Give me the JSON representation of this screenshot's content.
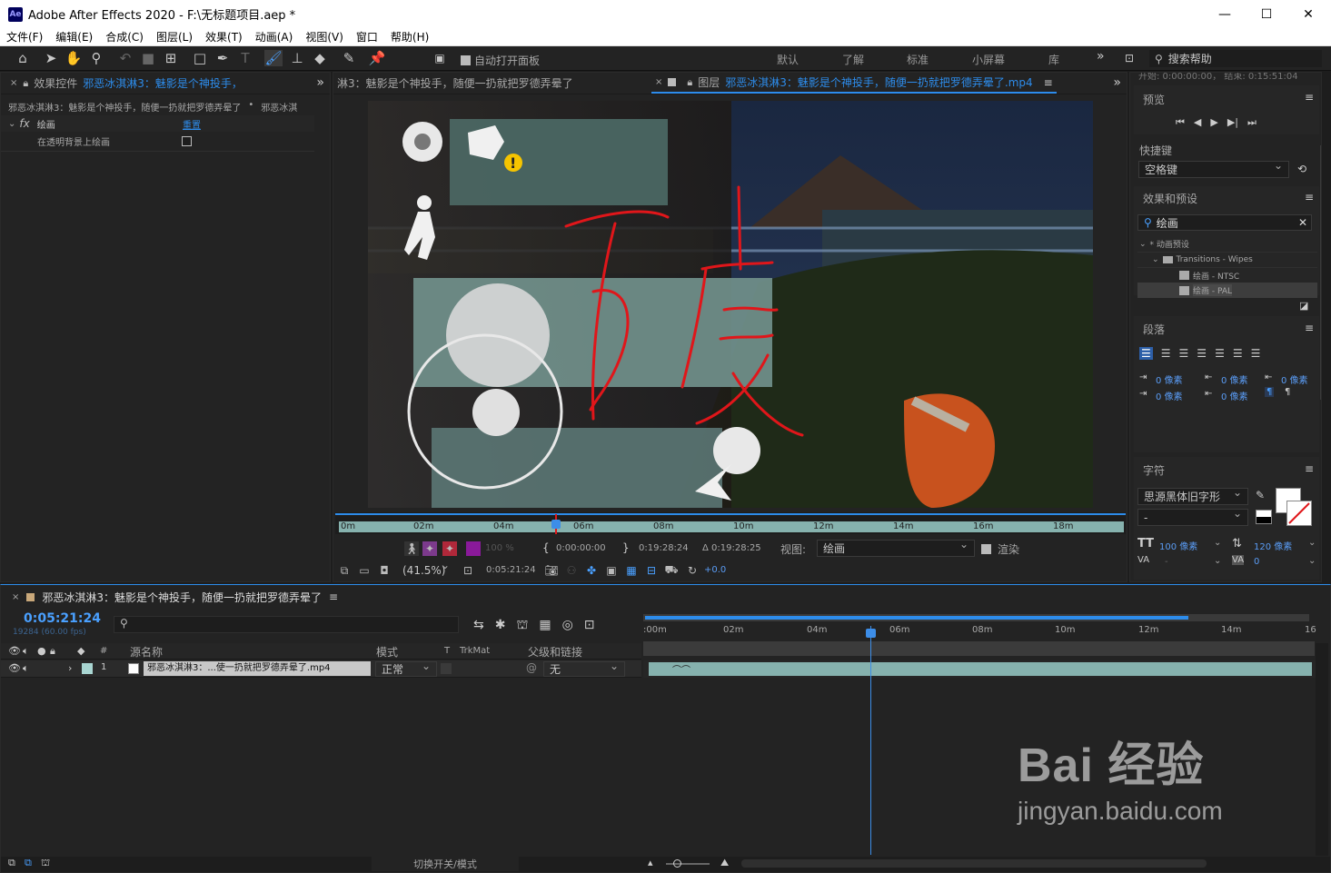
{
  "window": {
    "app_icon": "Ae",
    "title": "Adobe After Effects 2020 - F:\\无标题项目.aep *",
    "minimize": "—",
    "maximize": "☐",
    "close": "✕"
  },
  "menu": [
    "文件(F)",
    "编辑(E)",
    "合成(C)",
    "图层(L)",
    "效果(T)",
    "动画(A)",
    "视图(V)",
    "窗口",
    "帮助(H)"
  ],
  "toolbar": {
    "auto_open_label": "自动打开面板",
    "auto_open_checked": true,
    "workspaces": [
      "默认",
      "了解",
      "标准",
      "小屏幕",
      "库"
    ],
    "more": "»",
    "search_help": "搜索帮助"
  },
  "effect_controls": {
    "close": "×",
    "tab_prefix": "效果控件",
    "tab_layer": "邪恶冰淇淋3：魅影是个神投手，",
    "more": "»",
    "breadcrumb_a": "邪恶冰淇淋3：魅影是个神投手，随便一扔就把罗德弄晕了",
    "breadcrumb_sep": "•",
    "breadcrumb_b": "邪恶冰淇",
    "effect_name": "绘画",
    "reset": "重置",
    "prop_label": "在透明背景上绘画",
    "prop_checked": false
  },
  "layer_viewer": {
    "tab_left": "淋3：魅影是个神投手，随便一扔就把罗德弄晕了",
    "tab_prefix": "图层",
    "tab_name": "邪恶冰淇淋3：魅影是个神投手，随便一扔就把罗德弄晕了.mp4",
    "more": "»",
    "ruler": [
      "0m",
      "02m",
      "04m",
      "06m",
      "08m",
      "10m",
      "12m",
      "14m",
      "16m",
      "18m"
    ],
    "opacity": "100 %",
    "in_time": "0:00:00:00",
    "out_time": "0:19:28:24",
    "duration": "Δ 0:19:28:25",
    "view_label": "视图:",
    "view_value": "绘画",
    "render_label": "渲染",
    "render_checked": true,
    "zoom": "(41.5%)",
    "current_time": "0:05:21:24",
    "exposure": "+0.0"
  },
  "right_panel": {
    "cut_text": "开始: 0:00:00:00，  结束: 0:15:51:04",
    "preview_title": "预览",
    "shortcut_label": "快捷键",
    "shortcut_value": "空格键",
    "effects_title": "效果和预设",
    "effects_search": "绘画",
    "tree": [
      {
        "label": "* 动画预设",
        "level": 0,
        "selected": false
      },
      {
        "label": "Transitions - Wipes",
        "level": 1,
        "selected": false
      },
      {
        "label": "绘画 - NTSC",
        "level": 2,
        "selected": false
      },
      {
        "label": "绘画 - PAL",
        "level": 2,
        "selected": true
      }
    ],
    "paragraph_title": "段落",
    "px_values": [
      "0 像素",
      "0 像素",
      "0 像素",
      "0 像素",
      "0 像素"
    ],
    "char_title": "字符",
    "font_family": "思源黑体旧字形",
    "font_style": "-",
    "font_size": "100 像素",
    "leading": "120 像素",
    "kerning": "-",
    "tracking": "0",
    "menu_glyph": "≡",
    "fill_color": "#ffffff"
  },
  "timeline": {
    "close": "×",
    "comp_name": "邪恶冰淇淋3：魅影是个神投手，随便一扔就把罗德弄晕了",
    "menu": "≡",
    "current_time": "0:05:21:24",
    "frame_info": "19284 (60.00 fps)",
    "columns": {
      "num": "#",
      "source": "源名称",
      "mode": "模式",
      "t": "T",
      "trkmat": "TrkMat",
      "parent": "父级和链接"
    },
    "layer": {
      "index": "1",
      "name": "邪恶冰淇淋3：...使一扔就把罗德弄晕了.mp4",
      "mode": "正常",
      "parent": "无"
    },
    "ruler": [
      ":00m",
      "02m",
      "04m",
      "06m",
      "08m",
      "10m",
      "12m",
      "14m",
      "16"
    ],
    "footer_toggle": "切换开关/模式"
  },
  "colors": {
    "accent": "#2d8ceb",
    "panel": "#232323",
    "bg": "#1d1d1d",
    "layer_bar": "#86b2ae",
    "playhead": "#3d8ee8"
  },
  "watermark": {
    "brand": "Bai 经验",
    "url": "jingyan.baidu.com"
  }
}
